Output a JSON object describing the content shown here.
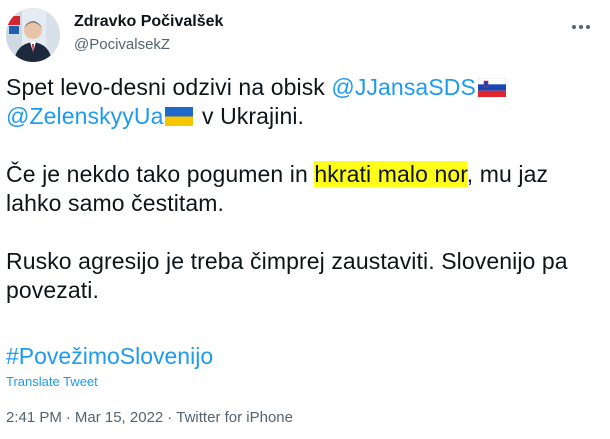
{
  "author": {
    "display_name": "Zdravko Počivalšek",
    "handle": "@PocivalsekZ",
    "avatar_icon": "profile-photo-avatar"
  },
  "more_button_icon": "more-horizontal-icon",
  "tweet": {
    "p1_text1": "Spet levo-desni odzivi na obisk ",
    "p1_mention1": "@JJansaSDS",
    "p1_flag1": "slovenia-flag-icon",
    "p1_mention2": "@ZelenskyyUa",
    "p1_flag2": "ukraine-flag-icon",
    "p1_text2": " v Ukrajini.",
    "p2_text1": "Če je nekdo tako pogumen in ",
    "p2_highlight": "hkrati malo nor",
    "p2_text2": ", mu jaz lahko samo čestitam.",
    "p3_text": "Rusko agresijo je treba čimprej zaustaviti. Slovenijo pa povezati.",
    "hashtag": "#PovežimoSlovenijo",
    "highlight_color": "#ffff1a"
  },
  "translate_label": "Translate Tweet",
  "meta": {
    "time": "2:41 PM",
    "separator": "·",
    "date": "Mar 15, 2022",
    "source": "Twitter for iPhone"
  },
  "colors": {
    "link": "#1d9bf0",
    "text": "#0f1419",
    "secondary": "#536471"
  }
}
